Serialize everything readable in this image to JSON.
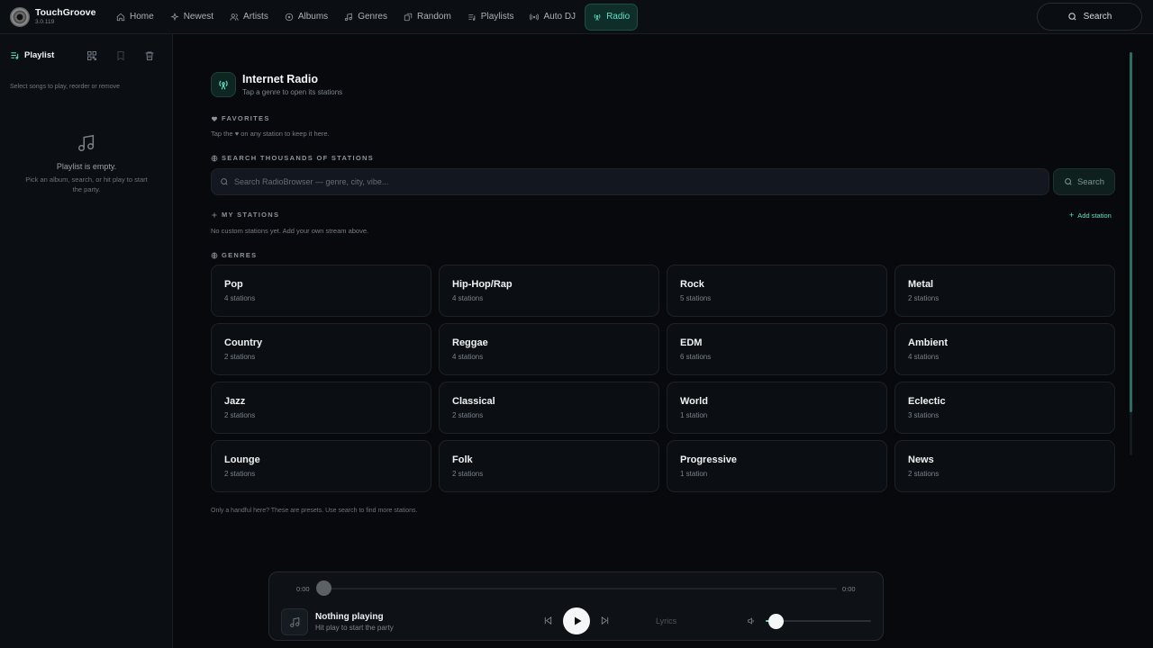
{
  "app": {
    "name": "TouchGroove",
    "version": "3.0.119"
  },
  "nav": [
    {
      "label": "Home",
      "icon": "home-icon",
      "active": false
    },
    {
      "label": "Newest",
      "icon": "sparkle-icon",
      "active": false
    },
    {
      "label": "Artists",
      "icon": "users-icon",
      "active": false
    },
    {
      "label": "Albums",
      "icon": "disc-icon",
      "active": false
    },
    {
      "label": "Genres",
      "icon": "music-note-icon",
      "active": false
    },
    {
      "label": "Random",
      "icon": "shuffle-icon",
      "active": false
    },
    {
      "label": "Playlists",
      "icon": "list-music-icon",
      "active": false
    },
    {
      "label": "Auto DJ",
      "icon": "broadcast-icon",
      "active": false
    },
    {
      "label": "Radio",
      "icon": "radio-tower-icon",
      "active": true
    }
  ],
  "top_search": {
    "label": "Search"
  },
  "sidebar": {
    "title": "Playlist",
    "hint": "Select songs to play, reorder or remove",
    "empty_title": "Playlist is empty.",
    "empty_sub": "Pick an album, search, or hit play to start the party."
  },
  "radio": {
    "title": "Internet Radio",
    "subtitle": "Tap a genre to open its stations",
    "favorites_label": "FAVORITES",
    "favorites_text_before": "Tap the",
    "favorites_heart": "♥",
    "favorites_text_after": "on any station to keep it here.",
    "search_label": "SEARCH THOUSANDS OF STATIONS",
    "search_placeholder": "Search RadioBrowser — genre, city, vibe...",
    "search_button": "Search",
    "my_stations_label": "MY STATIONS",
    "add_station": "Add station",
    "my_stations_text": "No custom stations yet. Add your own stream above.",
    "genres_label": "GENRES",
    "genres": [
      {
        "name": "Pop",
        "count": "4 stations"
      },
      {
        "name": "Hip-Hop/Rap",
        "count": "4 stations"
      },
      {
        "name": "Rock",
        "count": "5 stations"
      },
      {
        "name": "Metal",
        "count": "2 stations"
      },
      {
        "name": "Country",
        "count": "2 stations"
      },
      {
        "name": "Reggae",
        "count": "4 stations"
      },
      {
        "name": "EDM",
        "count": "6 stations"
      },
      {
        "name": "Ambient",
        "count": "4 stations"
      },
      {
        "name": "Jazz",
        "count": "2 stations"
      },
      {
        "name": "Classical",
        "count": "2 stations"
      },
      {
        "name": "World",
        "count": "1 station"
      },
      {
        "name": "Eclectic",
        "count": "3 stations"
      },
      {
        "name": "Lounge",
        "count": "2 stations"
      },
      {
        "name": "Folk",
        "count": "2 stations"
      },
      {
        "name": "Progressive",
        "count": "1 station"
      },
      {
        "name": "News",
        "count": "2 stations"
      }
    ],
    "footer_note": "Only a handful here? These are presets. Use search to find more stations."
  },
  "player": {
    "time_current": "0:00",
    "time_total": "0:00",
    "title": "Nothing playing",
    "subtitle": "Hit play to start the party",
    "lyrics_label": "Lyrics",
    "progress": 0,
    "volume": 0.1
  },
  "colors": {
    "accent": "#5fe0c4",
    "background": "#07090c",
    "panel": "#0b0e12"
  }
}
